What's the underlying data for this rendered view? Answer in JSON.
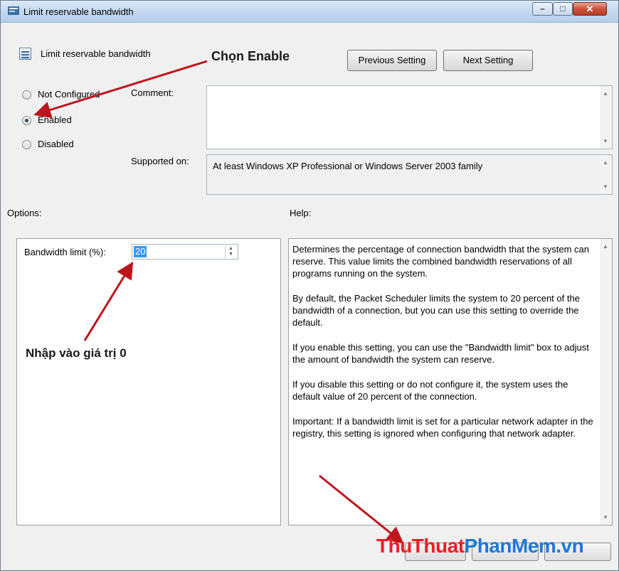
{
  "window": {
    "title": "Limit reservable bandwidth",
    "controls": {
      "minimize": "–",
      "maximize": "□",
      "close": "✕"
    }
  },
  "header": {
    "setting_name": "Limit reservable bandwidth",
    "previous_button": "Previous Setting",
    "next_button": "Next Setting"
  },
  "state": {
    "options": [
      {
        "label": "Not Configured",
        "checked": false
      },
      {
        "label": "Enabled",
        "checked": true
      },
      {
        "label": "Disabled",
        "checked": false
      }
    ]
  },
  "comment": {
    "label": "Comment:",
    "value": ""
  },
  "supported": {
    "label": "Supported on:",
    "value": "At least Windows XP Professional or Windows Server 2003 family"
  },
  "options_section": {
    "label": "Options:",
    "bandwidth_label": "Bandwidth limit (%):",
    "bandwidth_value": "20"
  },
  "help_section": {
    "label": "Help:",
    "paragraphs": [
      "Determines the percentage of connection bandwidth that the system can reserve. This value limits the combined bandwidth reservations of all programs running on the system.",
      "By default, the Packet Scheduler limits the system to 20 percent of the bandwidth of a connection, but you can use this setting to override the default.",
      "If you enable this setting, you can use the \"Bandwidth limit\" box to adjust the amount of bandwidth the system can reserve.",
      "If you disable this setting or do not configure it, the system uses the default value of 20 percent of the connection.",
      "Important: If a bandwidth limit is set for a particular network adapter in the registry, this setting is ignored when configuring that network adapter."
    ]
  },
  "annotations": {
    "choose_enable": "Chọn Enable",
    "enter_value": "Nhập vào giá trị 0",
    "arrow_color": "#c0141c"
  },
  "watermark": {
    "part1": "ThuThuat",
    "part2": "PhanMem",
    "part3": ".vn"
  }
}
